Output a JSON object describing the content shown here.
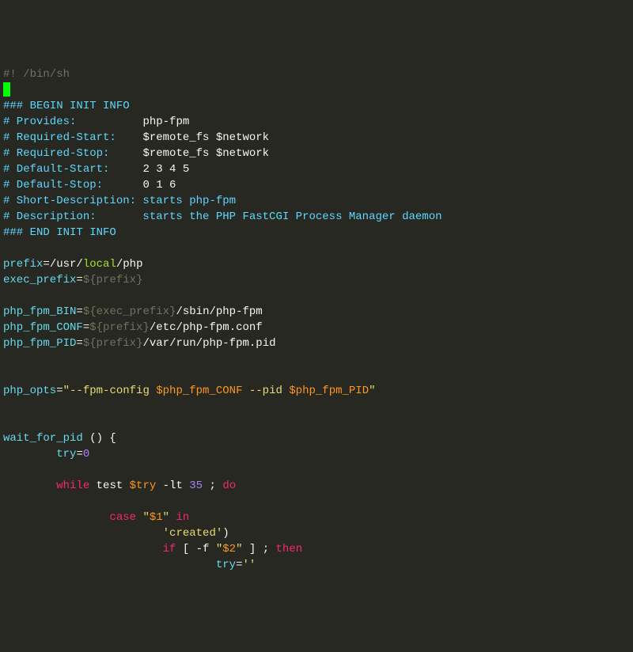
{
  "l01": {
    "a": "#! /bin/sh"
  },
  "l03": {
    "a": "### BEGIN INIT INFO"
  },
  "l04": {
    "a": "# Provides:          ",
    "b": "php-fpm"
  },
  "l05": {
    "a": "# Required-Start:    ",
    "b": "$remote_fs $network"
  },
  "l06": {
    "a": "# Required-Stop:     ",
    "b": "$remote_fs $network"
  },
  "l07": {
    "a": "# Default-Start:     ",
    "b": "2 3 4 5"
  },
  "l08": {
    "a": "# Default-Stop:      ",
    "b": "0 1 6"
  },
  "l09": {
    "a": "# Short-Description: starts php-fpm"
  },
  "l10": {
    "a": "# Description:       starts the PHP FastCGI Process Manager daemon"
  },
  "l11": {
    "a": "### END INIT INFO"
  },
  "l13": {
    "a": "prefix",
    "b": "=",
    "c": "/usr/",
    "d": "local",
    "e": "/php"
  },
  "l14": {
    "a": "exec_prefix",
    "b": "=",
    "c": "${",
    "d": "prefix",
    "e": "}"
  },
  "l16": {
    "a": "php_fpm_BIN",
    "b": "=",
    "c": "${",
    "d": "exec_prefix",
    "e": "}",
    "f": "/sbin/php-fpm"
  },
  "l17": {
    "a": "php_fpm_CONF",
    "b": "=",
    "c": "${",
    "d": "prefix",
    "e": "}",
    "f": "/etc/php-fpm.conf"
  },
  "l18": {
    "a": "php_fpm_PID",
    "b": "=",
    "c": "${",
    "d": "prefix",
    "e": "}",
    "f": "/var/run/php-fpm.pid"
  },
  "l21": {
    "a": "php_opts",
    "b": "=",
    "c": "\"",
    "d": "--fpm-config ",
    "e": "$php_fpm_CONF",
    "f": " --pid ",
    "g": "$php_fpm_PID",
    "h": "\""
  },
  "l24": {
    "a": "wait_for_pid ",
    "b": "()",
    "c": " {"
  },
  "l25": {
    "a": "        ",
    "b": "try",
    "c": "=",
    "d": "0"
  },
  "l27": {
    "a": "        ",
    "b": "while",
    "c": " test ",
    "d": "$try",
    "e": " -lt ",
    "f": "35",
    "g": " ; ",
    "h": "do"
  },
  "l29": {
    "a": "                ",
    "b": "case",
    "c": " ",
    "d": "\"",
    "e": "$1",
    "f": "\"",
    "g": " ",
    "h": "in"
  },
  "l30": {
    "a": "                        ",
    "b": "'created'",
    "c": ")"
  },
  "l31": {
    "a": "                        ",
    "b": "if",
    "c": " [ -f ",
    "d": "\"",
    "e": "$2",
    "f": "\"",
    "g": " ] ; ",
    "h": "then"
  },
  "l32": {
    "a": "                                ",
    "b": "try",
    "c": "=",
    "d": "''"
  }
}
